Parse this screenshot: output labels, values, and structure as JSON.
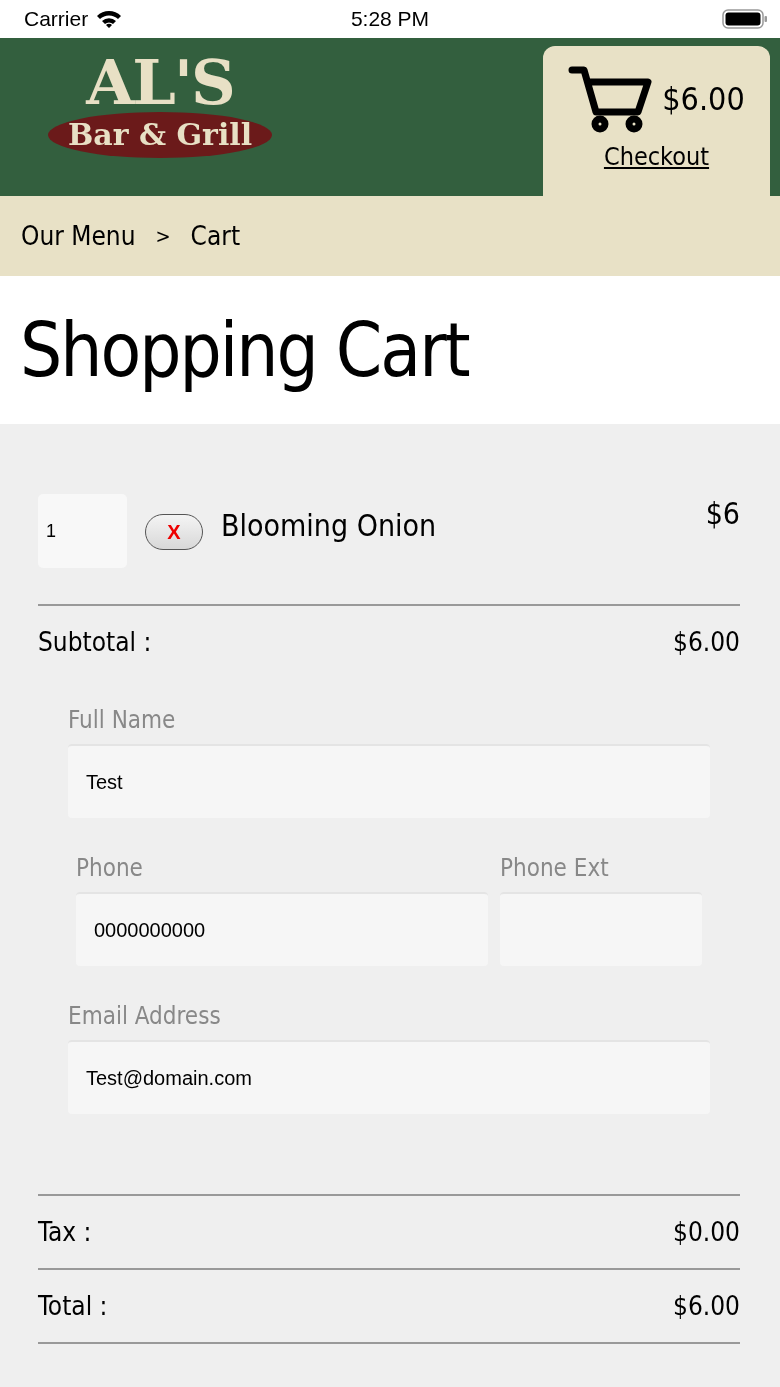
{
  "status_bar": {
    "carrier": "Carrier",
    "time": "5:28 PM"
  },
  "header": {
    "logo_title": "AL'S",
    "logo_subtitle": "Bar & Grill",
    "cart_total": "$6.00",
    "checkout": "Checkout"
  },
  "breadcrumb": [
    "Our Menu",
    ">",
    "Cart"
  ],
  "title": "Shopping Cart",
  "items": [
    {
      "quantity": "1",
      "remove": "X",
      "name": "Blooming Onion",
      "price": "$6"
    }
  ],
  "subtotal": {
    "label": "Subtotal :",
    "value": "$6.00"
  },
  "form": [
    {
      "label": "Full Name",
      "value": "Test"
    },
    {
      "label": "Phone",
      "value": "0000000000"
    },
    {
      "label": "Phone Ext"
    },
    {
      "label": "Email Address",
      "value": "Test@domain.com"
    }
  ],
  "totals": [
    {
      "label": "Tax :",
      "value": "$0.00"
    },
    {
      "label": "Total :",
      "value": "$6.00"
    }
  ]
}
